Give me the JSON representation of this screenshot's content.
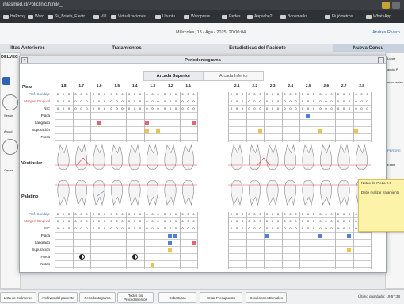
{
  "browser": {
    "url": "ihlasmed.cl/Policlinic.html#_",
    "bookmarks": [
      {
        "label": "HaProxy"
      },
      {
        "label": "Word"
      },
      {
        "label": "Sii_Boleta_Electr..."
      },
      {
        "label": "VIII"
      },
      {
        "label": "Virtualizaciones"
      },
      {
        "label": "Ubuntu"
      },
      {
        "label": "Wordpress"
      },
      {
        "label": "Redes"
      },
      {
        "label": "Aapache2"
      },
      {
        "label": "Bookmarks"
      },
      {
        "label": "Flujómetros"
      },
      {
        "label": "WhatsApp"
      }
    ]
  },
  "header": {
    "date": "Miércoles, 13 / Ago / 2025, 20:00:04",
    "user": "Andrés Rivero",
    "tabs": [
      "lltas Anteriores",
      "Tratamientos",
      "Estadísticas del Paciente",
      "Nueva Consu"
    ]
  },
  "background": {
    "left_tab": "DELVEC",
    "left_labels": [
      "Sesión",
      "Arcad",
      "Gener"
    ],
    "right_labels": [
      "Lugar",
      "ación P",
      "ment anteo",
      "PERORE",
      "Exám"
    ]
  },
  "modal": {
    "title": "Periodontograma",
    "arcade_upper": "Arcada Superior",
    "arcade_lower": "Arcada Inferior",
    "piece_label": "Pieza",
    "teeth_left": [
      "1.8",
      "1.7",
      "1.6",
      "1.5",
      "1.4",
      "1.3",
      "1.2",
      "1.1"
    ],
    "teeth_right": [
      "2.1",
      "2.2",
      "2.3",
      "2.4",
      "2.5",
      "2.6",
      "2.7",
      "2.8"
    ],
    "upper_rows": [
      "Prof. Sondaje",
      "Margen Gingival",
      "NIC",
      "Placa",
      "Sangrado",
      "Supuración",
      "Furca"
    ],
    "lower_rows": [
      "Prof. Sondaje",
      "Margen Gingival",
      "NIC",
      "Placa",
      "Sangrado",
      "Supuración",
      "Furca",
      "Notas"
    ],
    "vestibular": "Vestibular",
    "palatino": "Palatino",
    "value_zero": "0",
    "value_neg": "-2"
  },
  "note": {
    "title": "Notas de Pieza 2.6",
    "body": "Debe realizar tratamiento"
  },
  "bottom": {
    "buttons": [
      "Lista de Exámenes",
      "Archivos del paciente",
      "Periodontograma",
      "Todos los Procedimientos",
      "Coberturas",
      "Crear Presupuesto",
      "Condiciones Dentales"
    ],
    "status": "Último guardado: 19:57:38"
  },
  "colors": {
    "accent": "#3a6fb0",
    "bleeding": "#e8636f",
    "plaque": "#4f7fd6",
    "suppuration": "#f0c24a",
    "note": "#fdf3a8",
    "margin_line": "#e05050"
  }
}
